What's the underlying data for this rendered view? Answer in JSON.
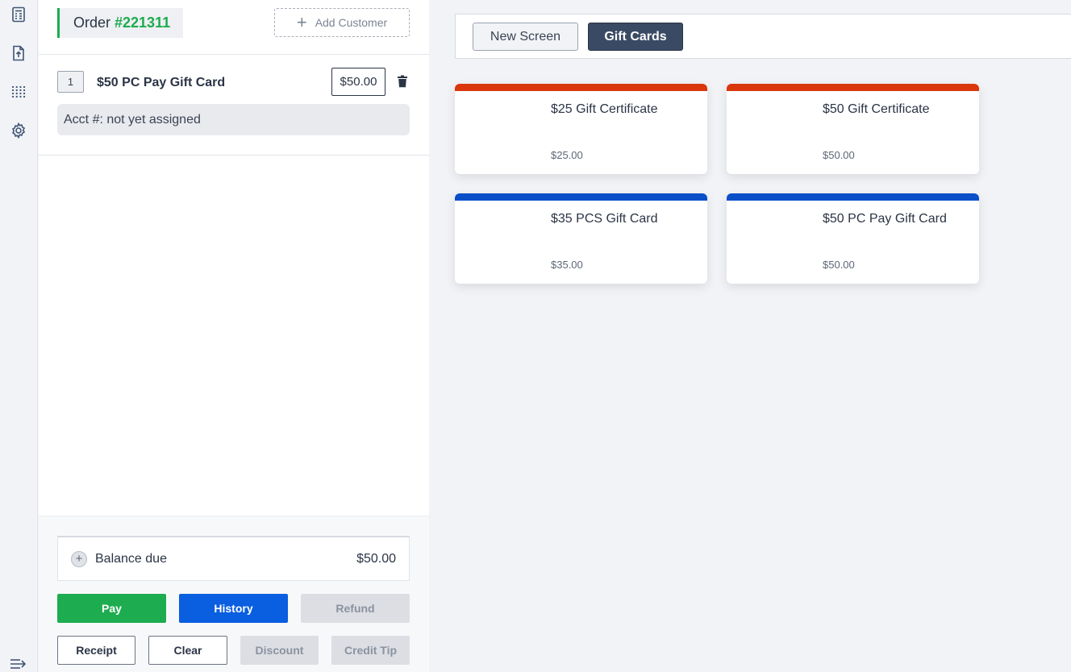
{
  "colors": {
    "green": "#1dac4f",
    "blue": "#0a5ee0",
    "tile_orange": "#d9360b",
    "tile_blue": "#0a4fc9",
    "dark_tab": "#3b4a64"
  },
  "rail": {
    "icons": [
      "calculator-icon",
      "file-upload-icon",
      "grid-dots-icon",
      "gear-icon"
    ],
    "collapse_icon": "collapse-menu-icon"
  },
  "order": {
    "prefix": "Order ",
    "number": "#221311",
    "add_customer_label": "Add Customer",
    "items": [
      {
        "qty": "1",
        "name": "$50 PC Pay Gift Card",
        "price": "$50.00",
        "acct": "Acct #: not yet assigned"
      }
    ]
  },
  "totals": {
    "balance_label": "Balance due",
    "balance_value": "$50.00"
  },
  "actions": {
    "pay": "Pay",
    "history": "History",
    "refund": "Refund",
    "receipt": "Receipt",
    "clear": "Clear",
    "discount": "Discount",
    "credit_tip": "Credit Tip"
  },
  "screens": {
    "tabs": [
      {
        "label": "New Screen",
        "active": false
      },
      {
        "label": "Gift Cards",
        "active": true
      }
    ]
  },
  "tiles": [
    {
      "name": "$25 Gift Certificate",
      "price": "$25.00",
      "color": "#d9360b"
    },
    {
      "name": "$50 Gift Certificate",
      "price": "$50.00",
      "color": "#d9360b"
    },
    {
      "name": "$35 PCS Gift Card",
      "price": "$35.00",
      "color": "#0a4fc9"
    },
    {
      "name": "$50 PC Pay Gift Card",
      "price": "$50.00",
      "color": "#0a4fc9"
    }
  ]
}
